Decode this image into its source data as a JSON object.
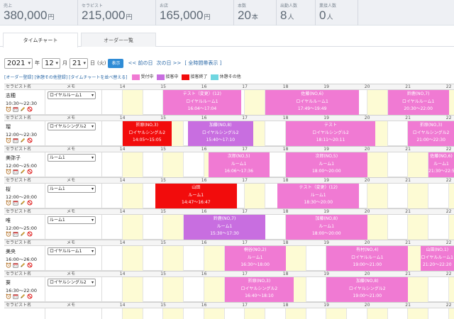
{
  "stats": [
    {
      "label": "売上",
      "value": "380,000",
      "unit": "円"
    },
    {
      "label": "セラピスト",
      "value": "215,000",
      "unit": "円"
    },
    {
      "label": "お店",
      "value": "165,000",
      "unit": "円"
    },
    {
      "label": "本数",
      "value": "20",
      "unit": "本"
    },
    {
      "label": "出勤人数",
      "value": "8",
      "unit": "人"
    },
    {
      "label": "業接人数",
      "value": "0",
      "unit": "人"
    }
  ],
  "tabs": [
    {
      "label": "タイムチャート"
    },
    {
      "label": "オーダー一覧"
    }
  ],
  "datebar": {
    "year": "2021",
    "year_unit": "年",
    "month": "12",
    "month_unit": "月",
    "day": "21",
    "day_unit": "日",
    "weekday": "(火)",
    "show_button": "表示",
    "prev_day": "<< 前の日",
    "next_day": "次の日 >>",
    "full_time": "[ 全時間帯表示 ]"
  },
  "legend": {
    "links": "[オーダー登録] [休憩その他登録] [タイムチャートを並べ替える]",
    "items": [
      {
        "label": "受付中",
        "color": "#f07ad3"
      },
      {
        "label": "接客中",
        "color": "#c86ee0"
      },
      {
        "label": "接客終了",
        "color": "#f20c0c"
      },
      {
        "label": "休憩その他",
        "color": "#6fd6e0"
      }
    ]
  },
  "header": {
    "name_col": "セラピスト名",
    "memo_col": "メモ",
    "hours": [
      "14",
      "15",
      "16",
      "17",
      "18",
      "19",
      "20",
      "21",
      "22"
    ]
  },
  "colors": {
    "accepting": "#f07ad3",
    "serving": "#c86ee0",
    "finished": "#f20c0c",
    "slot_active": "#fdfbd4"
  },
  "staff": [
    {
      "name": "志穂",
      "hours": "10:30〜22:30",
      "memo": "ロイヤルルーム1",
      "bookings": [
        {
          "start": 15,
          "end": 16.9,
          "type": "pink",
          "lines": [
            "テスト（変更）(12)",
            "ロイヤルルーム1",
            "16:04〜17:04"
          ]
        },
        {
          "start": 17.5,
          "end": 19.8,
          "type": "pink",
          "lines": [
            "佐藤(NO,6)",
            "ロイヤルルーム1",
            "17:49〜19:49"
          ]
        },
        {
          "start": 20.5,
          "end": 22,
          "type": "pink",
          "lines": [
            "鈴鹿(NO,7)",
            "ロイヤルルーム1",
            "20:30〜22:00"
          ]
        }
      ]
    },
    {
      "name": "瑠",
      "hours": "12:00〜22:30",
      "memo": "ロイヤルシングル2",
      "bookings": [
        {
          "start": 14,
          "end": 15.2,
          "type": "red",
          "lines": [
            "折原(NO,3)",
            "ロイヤルシングル2",
            "14:05〜15:05"
          ]
        },
        {
          "start": 15.6,
          "end": 17.2,
          "type": "purple",
          "lines": [
            "加藤(NO,8)",
            "ロイヤルシングル2",
            "15:40〜17:10"
          ]
        },
        {
          "start": 18,
          "end": 20.2,
          "type": "pink",
          "lines": [
            "テスト",
            "ロイヤルシングル2",
            "18:11〜20:11"
          ]
        },
        {
          "start": 21,
          "end": 22.6,
          "type": "pink",
          "lines": [
            "折原(NO,3)",
            "ロイヤルシングル2",
            "21:00〜22:30"
          ]
        }
      ]
    },
    {
      "name": "美弥子",
      "hours": "12:00〜25:00",
      "memo": "ルーム1",
      "bookings": [
        {
          "start": 16.1,
          "end": 17.6,
          "type": "pink",
          "lines": [
            "次郎(NO,5)",
            "ルーム1",
            "16:06〜17:36"
          ]
        },
        {
          "start": 18,
          "end": 20,
          "type": "pink",
          "lines": [
            "次郎(NO,5)",
            "ルーム1",
            "18:00〜20:00"
          ]
        },
        {
          "start": 21.5,
          "end": 22.8,
          "type": "pink",
          "lines": [
            "佐藤(NO,6)",
            "ルーム1",
            "21:30〜22:50"
          ]
        }
      ]
    },
    {
      "name": "桜",
      "hours": "12:00〜20:00",
      "memo": "ルーム1",
      "bookings": [
        {
          "start": 14.8,
          "end": 16.8,
          "type": "red",
          "lines": [
            "山田",
            "ルーム1",
            "14:47〜16:47"
          ]
        },
        {
          "start": 17.8,
          "end": 19.8,
          "type": "pink",
          "lines": [
            "テスト（変更）(12)",
            "ルーム1",
            "18:30〜20:00"
          ]
        }
      ]
    },
    {
      "name": "唯",
      "hours": "12:00〜25:00",
      "memo": "ルーム1",
      "bookings": [
        {
          "start": 15.5,
          "end": 17.5,
          "type": "purple",
          "lines": [
            "鈴鹿(NO,7)",
            "ルーム1",
            "15:30〜17:30"
          ]
        },
        {
          "start": 18,
          "end": 20,
          "type": "pink",
          "lines": [
            "加藤(NO,8)",
            "ルーム1",
            "18:00〜20:00"
          ]
        }
      ]
    },
    {
      "name": "美央",
      "hours": "16:00〜26:00",
      "memo": "ロイヤルルーム1",
      "bookings": [
        {
          "start": 16.5,
          "end": 18,
          "type": "pink",
          "lines": [
            "桐谷(NO,2)",
            "ルーム1",
            "16:30〜18:00"
          ]
        },
        {
          "start": 19,
          "end": 21,
          "type": "pink",
          "lines": [
            "有村(NO,4)",
            "ロイヤルルーム1",
            "19:00〜21:00"
          ]
        },
        {
          "start": 21.3,
          "end": 22.6,
          "type": "pink",
          "lines": [
            "山田(NO,1)",
            "ロイヤルルーム1",
            "21:20〜22:20"
          ]
        }
      ]
    },
    {
      "name": "葵",
      "hours": "16:30〜22:00",
      "memo": "ロイヤルシングル2",
      "bookings": [
        {
          "start": 16.5,
          "end": 18.2,
          "type": "pink",
          "lines": [
            "折原(NO,3)",
            "ロイヤルシングル2",
            "16:40〜18:10"
          ]
        },
        {
          "start": 19,
          "end": 21,
          "type": "pink",
          "lines": [
            "加藤(NO,8)",
            "ロイヤルシングル2",
            "19:00〜21:00"
          ]
        }
      ]
    },
    {
      "name": "",
      "hours": "",
      "memo": "",
      "bookings": []
    }
  ]
}
